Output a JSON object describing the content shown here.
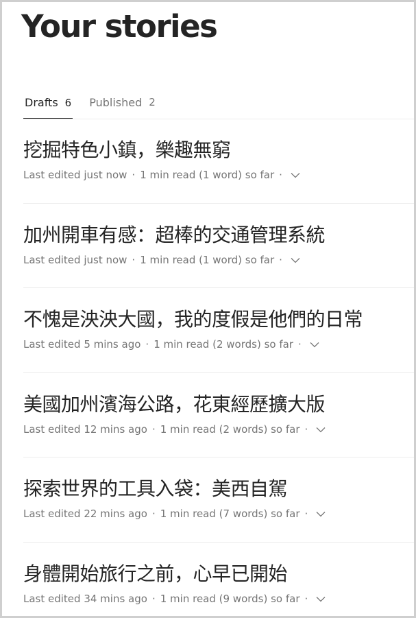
{
  "page": {
    "title": "Your stories"
  },
  "tabs": [
    {
      "label": "Drafts",
      "count": "6"
    },
    {
      "label": "Published",
      "count": "2"
    }
  ],
  "stories": [
    {
      "title": "挖掘特色小鎮，樂趣無窮",
      "edited": "Last edited just now",
      "read": "1 min read (1 word) so far"
    },
    {
      "title": "加州開車有感：超棒的交通管理系統",
      "edited": "Last edited just now",
      "read": "1 min read (1 word) so far"
    },
    {
      "title": "不愧是泱泱大國，我的度假是他們的日常",
      "edited": "Last edited 5 mins ago",
      "read": "1 min read (2 words) so far"
    },
    {
      "title": "美國加州濱海公路，花東經歷擴大版",
      "edited": "Last edited 12 mins ago",
      "read": "1 min read (2 words) so far"
    },
    {
      "title": "探索世界的工具入袋：美西自駕",
      "edited": "Last edited 22 mins ago",
      "read": "1 min read (7 words) so far"
    },
    {
      "title": "身體開始旅行之前，心早已開始",
      "edited": "Last edited 34 mins ago",
      "read": "1 min read (9 words) so far"
    }
  ],
  "separator": "·",
  "icons": {
    "story_menu": "chevron-down-icon"
  },
  "colors": {
    "text": "#242424",
    "muted": "#757575",
    "divider": "#ececec"
  }
}
